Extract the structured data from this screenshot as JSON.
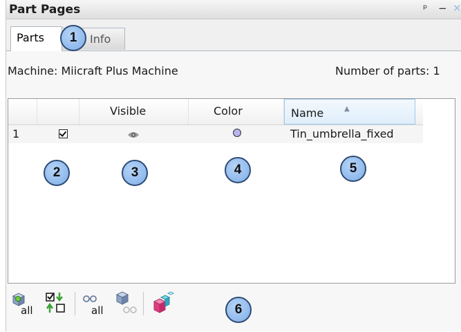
{
  "window": {
    "title": "Part Pages",
    "pin_glyph": "ᵖ",
    "minimize_glyph": "−"
  },
  "tabs": [
    {
      "label": "Parts",
      "active": true
    },
    {
      "label": "Info",
      "active": false
    }
  ],
  "machine_label": "Machine: Miicraft Plus Machine",
  "parts_count_label": "Number of parts: 1",
  "table": {
    "columns": [
      "",
      "",
      "Visible",
      "Color",
      "Name"
    ],
    "sorted_column": "Name",
    "rows": [
      {
        "index": "1",
        "selected": true,
        "visible_icon": "eye-icon",
        "color": "#b9b3ee",
        "name": "Tin_umbrella_fixed"
      }
    ]
  },
  "toolbar": {
    "items": [
      {
        "icon": "show-all-icon",
        "caption": "all"
      },
      {
        "icon": "toggle-selection-icon",
        "caption": ""
      },
      {
        "icon": "hide-all-icon",
        "caption": "all"
      },
      {
        "icon": "hide-selected-icon",
        "caption": ""
      },
      {
        "icon": "color-parts-icon",
        "caption": ""
      }
    ]
  },
  "callouts": [
    "1",
    "2",
    "3",
    "4",
    "5",
    "6"
  ],
  "colors": {
    "callout_fill": "#8db8ec",
    "callout_border": "#2d4a73",
    "part_color": "#b9b3ee"
  }
}
